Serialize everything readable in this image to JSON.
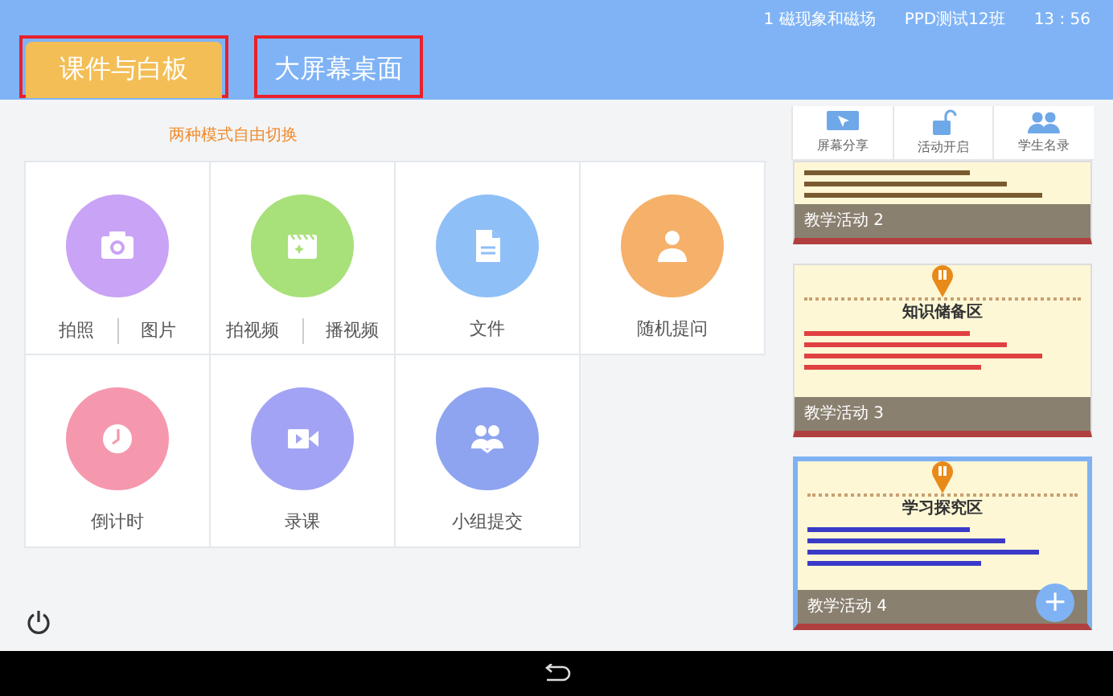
{
  "header": {
    "lesson": "1 磁现象和磁场",
    "class_name": "PPD测试12班",
    "time": "13 : 56"
  },
  "mode_tabs": [
    {
      "label": "课件与白板",
      "selected": true,
      "highlighted": true
    },
    {
      "label": "大屏幕桌面",
      "selected": false,
      "highlighted": true
    }
  ],
  "mode_hint": "两种模式自由切换",
  "tools": [
    {
      "kind": "camera",
      "color": "#c9a3f5",
      "labels": [
        "拍照",
        "图片"
      ]
    },
    {
      "kind": "clapper",
      "color": "#a8e07a",
      "labels": [
        "拍视频",
        "播视频"
      ]
    },
    {
      "kind": "file",
      "color": "#8fbff7",
      "labels": [
        "文件"
      ]
    },
    {
      "kind": "person",
      "color": "#f5b06a",
      "labels": [
        "随机提问"
      ]
    },
    {
      "kind": "clock",
      "color": "#f598ae",
      "labels": [
        "倒计时"
      ]
    },
    {
      "kind": "video",
      "color": "#a3a3f5",
      "labels": [
        "录课"
      ]
    },
    {
      "kind": "group",
      "color": "#8ea4f0",
      "labels": [
        "小组提交"
      ]
    }
  ],
  "side_toolbar": [
    {
      "kind": "screen",
      "label": "屏幕分享"
    },
    {
      "kind": "lock",
      "label": "活动开启"
    },
    {
      "kind": "users",
      "label": "学生名录"
    }
  ],
  "slides": [
    {
      "label": "教学活动 2",
      "selected": false,
      "partial": true
    },
    {
      "label": "教学活动 3",
      "heading": "知识储备区",
      "selected": false,
      "partial": false
    },
    {
      "label": "教学活动 4",
      "heading": "学习探究区",
      "selected": true,
      "partial": false
    }
  ],
  "add_button": "+"
}
